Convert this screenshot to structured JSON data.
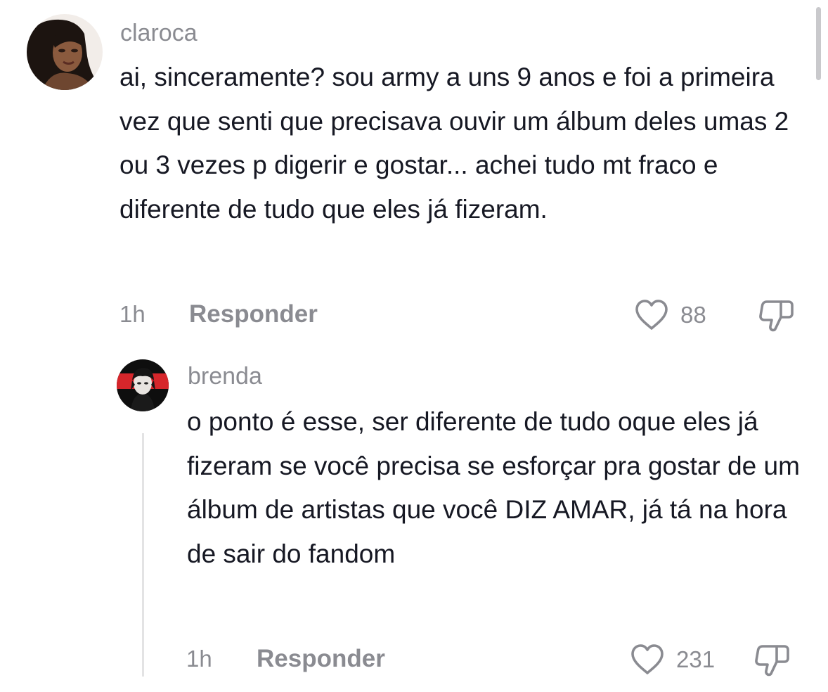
{
  "comments": [
    {
      "username": "claroca",
      "text": "ai, sinceramente? sou army a uns 9 anos e foi a primeira vez que senti que precisava ouvir um álbum deles umas 2 ou 3 vezes p digerir e gostar... achei tudo mt fraco e diferente de tudo que eles já fizeram.",
      "time": "1h",
      "reply_label": "Responder",
      "likes": "88"
    }
  ],
  "replies": [
    {
      "username": "brenda",
      "text": "o ponto é esse, ser diferente de tudo oque eles já fizeram se você precisa se esforçar pra gostar de um álbum de artistas que você DIZ AMAR, já tá na hora de sair do fandom",
      "time": "1h",
      "reply_label": "Responder",
      "likes": "231"
    }
  ],
  "icons": {
    "like": "heart-outline-icon",
    "dislike": "thumbs-down-outline-icon"
  },
  "colors": {
    "text": "#161823",
    "secondary": "#8a8b91",
    "accent_red": "#d6262b"
  }
}
